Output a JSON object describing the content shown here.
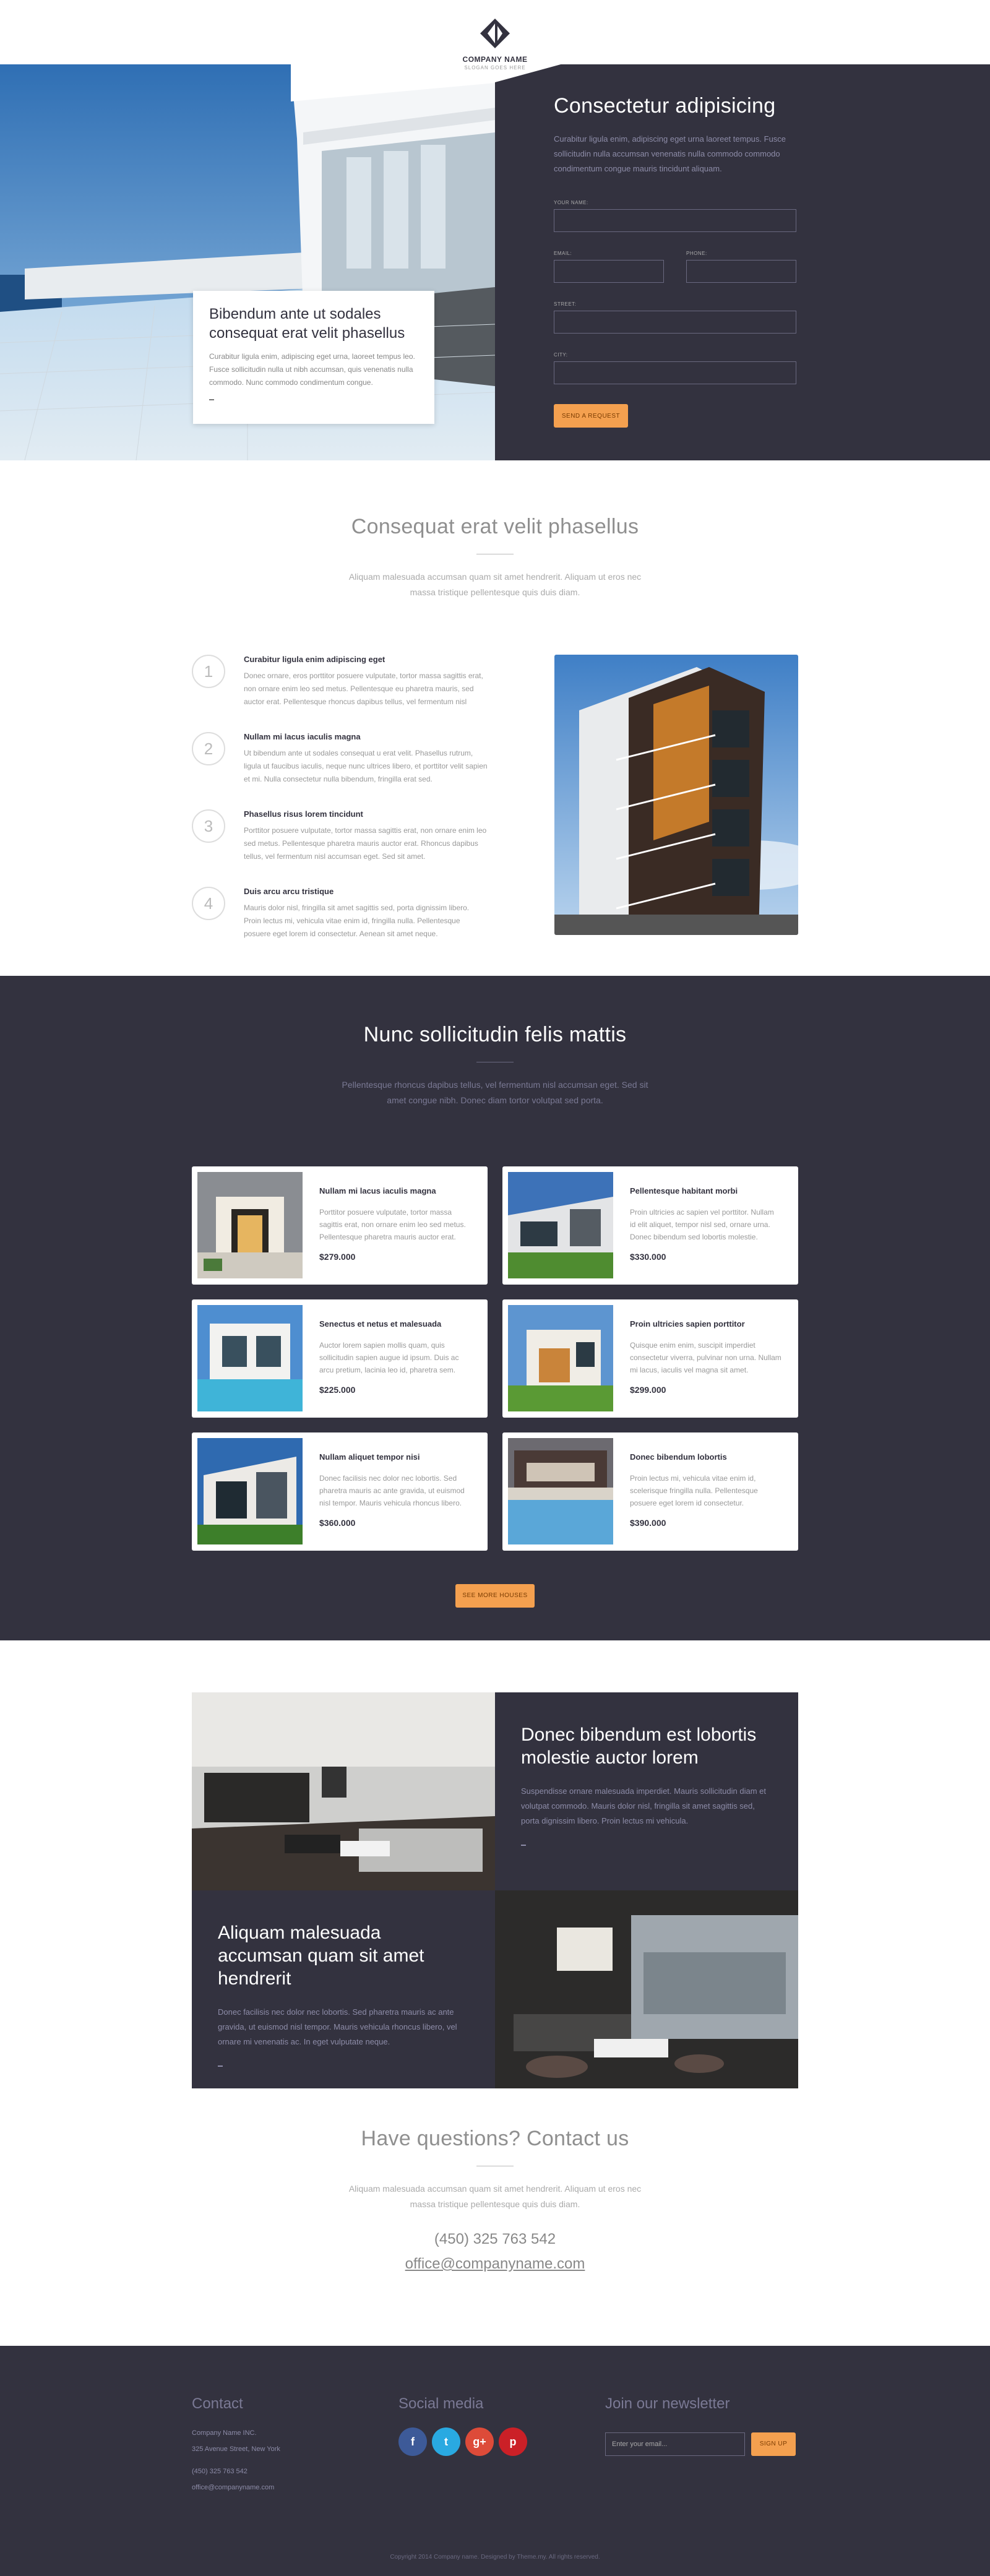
{
  "brand": {
    "name": "COMPANY NAME",
    "slogan": "SLOGAN GOES HERE"
  },
  "hero": {
    "card_title": "Bibendum ante ut sodales consequat erat velit phasellus",
    "card_text": "Curabitur ligula enim, adipiscing eget urna, laoreet tempus leo. Fusce sollicitudin nulla ut nibh accumsan, quis venenatis nulla commodo. Nunc commodo condimentum congue.",
    "form_title": "Consectetur adipisicing",
    "form_text": "Curabitur ligula enim, adipiscing eget urna laoreet tempus. Fusce sollicitudin nulla accumsan venenatis nulla commodo commodo condimentum congue mauris tincidunt aliquam.",
    "labels": {
      "name": "YOUR NAME:",
      "email": "EMAIL:",
      "phone": "PHONE:",
      "street": "STREET:",
      "city": "CITY:"
    },
    "submit": "SEND A REQUEST"
  },
  "how": {
    "title": "Consequat erat velit phasellus",
    "subtitle": "Aliquam malesuada accumsan quam sit amet hendrerit. Aliquam ut eros nec massa tristique pellentesque quis duis diam.",
    "steps": [
      {
        "n": "1",
        "title": "Curabitur ligula enim adipiscing eget",
        "text": "Donec ornare, eros porttitor posuere vulputate, tortor massa sagittis erat, non ornare enim leo sed metus. Pellentesque eu pharetra mauris, sed auctor erat. Pellentesque rhoncus dapibus tellus, vel fermentum nisl"
      },
      {
        "n": "2",
        "title": "Nullam mi lacus iaculis magna",
        "text": "Ut bibendum ante ut sodales consequat u erat velit. Phasellus rutrum, ligula ut faucibus iaculis, neque nunc ultrices libero, et porttitor velit sapien et mi. Nulla consectetur nulla bibendum, fringilla erat sed."
      },
      {
        "n": "3",
        "title": "Phasellus risus lorem tincidunt",
        "text": "Porttitor posuere vulputate, tortor massa sagittis erat, non ornare enim leo sed metus. Pellentesque pharetra mauris auctor erat. Rhoncus dapibus tellus, vel fermentum nisl accumsan eget. Sed sit amet."
      },
      {
        "n": "4",
        "title": "Duis arcu arcu tristique",
        "text": "Mauris dolor nisl, fringilla sit amet sagittis sed, porta dignissim libero. Proin lectus mi, vehicula vitae enim id, fringilla nulla. Pellentesque posuere eget lorem id consectetur. Aenean sit amet neque."
      }
    ]
  },
  "listings": {
    "title": "Nunc sollicitudin felis mattis",
    "subtitle": "Pellentesque rhoncus dapibus tellus, vel fermentum nisl accumsan eget. Sed sit amet congue nibh. Donec diam tortor volutpat sed porta.",
    "items": [
      {
        "title": "Nullam mi lacus iaculis magna",
        "text": "Porttitor posuere vulputate, tortor massa sagittis erat, non ornare enim leo sed metus. Pellentesque pharetra mauris auctor erat.",
        "price": "$279.000"
      },
      {
        "title": "Pellentesque habitant morbi",
        "text": "Proin ultricies ac sapien vel porttitor. Nullam id elit aliquet, tempor nisl sed, ornare urna. Donec bibendum sed lobortis molestie.",
        "price": "$330.000"
      },
      {
        "title": "Senectus et netus et malesuada",
        "text": "Auctor lorem sapien mollis quam, quis sollicitudin sapien augue id ipsum. Duis ac arcu pretium, lacinia leo id, pharetra sem.",
        "price": "$225.000"
      },
      {
        "title": "Proin ultricies sapien porttitor",
        "text": "Quisque enim enim, suscipit imperdiet consectetur viverra, pulvinar non urna. Nullam mi lacus, iaculis vel magna sit amet.",
        "price": "$299.000"
      },
      {
        "title": "Nullam aliquet tempor nisi",
        "text": "Donec facilisis nec dolor nec lobortis. Sed pharetra mauris ac ante gravida, ut euismod nisl tempor. Mauris vehicula rhoncus libero.",
        "price": "$360.000"
      },
      {
        "title": "Donec bibendum lobortis",
        "text": "Proin lectus mi, vehicula vitae enim id, scelerisque fringilla nulla. Pellentesque posuere eget lorem id consectetur.",
        "price": "$390.000"
      }
    ],
    "more": "SEE MORE HOUSES"
  },
  "features": {
    "a_title": "Donec bibendum est lobortis molestie auctor lorem",
    "a_text": "Suspendisse ornare malesuada imperdiet. Mauris sollicitudin diam et volutpat commodo. Mauris dolor nisl, fringilla sit amet sagittis sed, porta dignissim libero. Proin lectus mi vehicula.",
    "b_title": "Aliquam malesuada accumsan quam sit amet hendrerit",
    "b_text": "Donec facilisis nec dolor nec lobortis. Sed pharetra mauris ac ante gravida, ut euismod nisl tempor. Mauris vehicula rhoncus libero, vel ornare mi venenatis ac. In eget vulputate neque."
  },
  "contact": {
    "title": "Have questions? Contact us",
    "subtitle": "Aliquam malesuada accumsan quam sit amet hendrerit. Aliquam ut eros nec massa tristique pellentesque quis duis diam.",
    "phone": "(450) 325 763 542",
    "email": "office@companyname.com"
  },
  "footer": {
    "contact_title": "Contact",
    "address1": "Company Name INC.",
    "address2": "325 Avenue Street, New York",
    "phone": "(450) 325 763 542",
    "email": "office@companyname.com",
    "social_title": "Social media",
    "social": [
      {
        "icon": "facebook-icon",
        "glyph": "f",
        "color": "#3d5a98"
      },
      {
        "icon": "twitter-icon",
        "glyph": "t",
        "color": "#29a9e1"
      },
      {
        "icon": "google-plus-icon",
        "glyph": "g+",
        "color": "#dd4b39"
      },
      {
        "icon": "pinterest-icon",
        "glyph": "p",
        "color": "#cb2027"
      }
    ],
    "newsletter_title": "Join our newsletter",
    "newsletter_placeholder": "Enter your email...",
    "signup": "SIGN UP",
    "copyright": "Copyright 2014 Company name. Designed by Theme.my. All rights reserved."
  }
}
